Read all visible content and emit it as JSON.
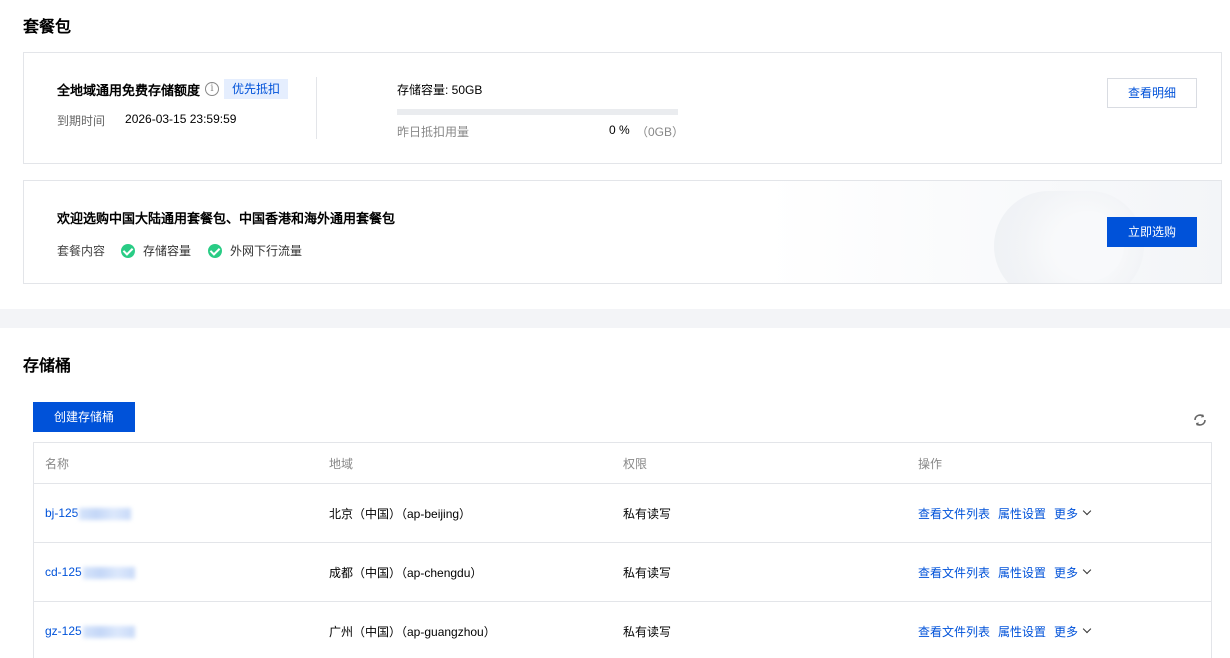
{
  "package_section": {
    "title": "套餐包",
    "card": {
      "name": "全地域通用免费存储额度",
      "tag": "优先抵扣",
      "expire_label": "到期时间",
      "expire_value": "2026-03-15 23:59:59",
      "capacity_label": "存储容量: 50GB",
      "usage_label": "昨日抵扣用量",
      "usage_percent": "0 %",
      "usage_percent_value": 0,
      "usage_gb": "（0GB）",
      "detail_button": "查看明细"
    },
    "promo": {
      "title": "欢迎选购中国大陆通用套餐包、中国香港和海外通用套餐包",
      "content_label": "套餐内容",
      "items": [
        "存储容量",
        "外网下行流量"
      ],
      "buy_button": "立即选购"
    }
  },
  "bucket_section": {
    "title": "存储桶",
    "create_button": "创建存储桶",
    "columns": [
      "名称",
      "地域",
      "权限",
      "操作"
    ],
    "rows": [
      {
        "name": "bj-125",
        "region": "北京（中国）（ap-beijing）",
        "permission": "私有读写",
        "ops": [
          "查看文件列表",
          "属性设置",
          "更多"
        ]
      },
      {
        "name": "cd-125",
        "region": "成都（中国）（ap-chengdu）",
        "permission": "私有读写",
        "ops": [
          "查看文件列表",
          "属性设置",
          "更多"
        ]
      },
      {
        "name": "gz-125",
        "region": "广州（中国）（ap-guangzhou）",
        "permission": "私有读写",
        "ops": [
          "查看文件列表",
          "属性设置",
          "更多"
        ]
      }
    ]
  },
  "colors": {
    "brand": "#0052d9",
    "success": "#29cc85",
    "tag_bg": "#e5eefe"
  }
}
